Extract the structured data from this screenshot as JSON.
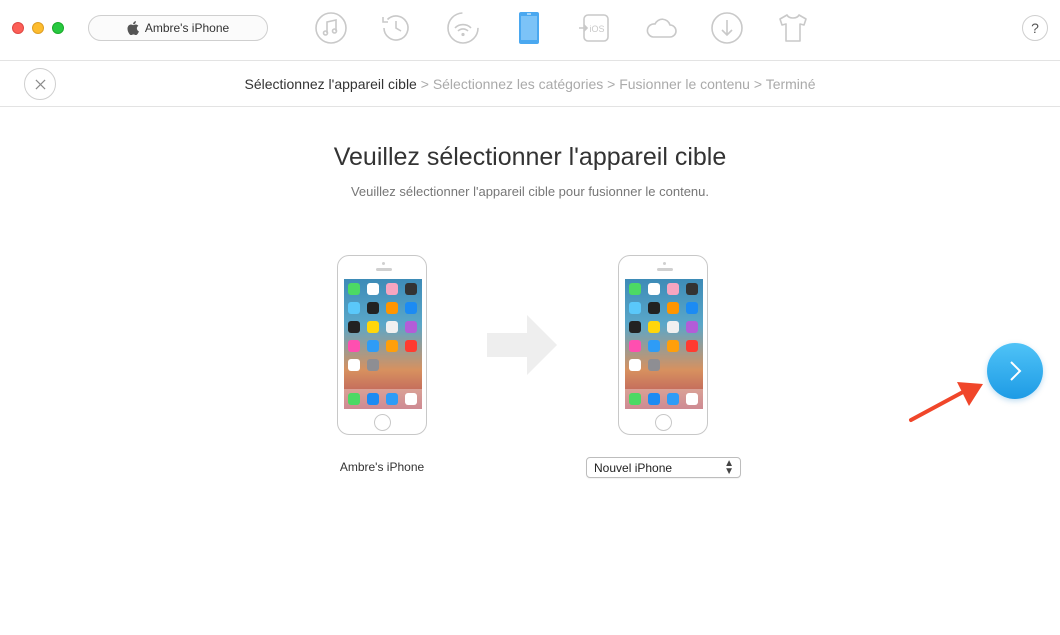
{
  "toolbar": {
    "device_name": "Ambre's iPhone",
    "icons": [
      "music-icon",
      "history-icon",
      "wifi-sync-icon",
      "iphone-icon",
      "ios-transfer-icon",
      "cloud-icon",
      "download-icon",
      "tshirt-icon"
    ],
    "active_icon": "iphone-icon",
    "help_label": "?"
  },
  "breadcrumb": {
    "steps": [
      "Sélectionnez l'appareil cible",
      "Sélectionnez les catégories",
      "Fusionner le contenu",
      "Terminé"
    ],
    "separator": " > ",
    "active_index": 0
  },
  "main": {
    "title": "Veuillez sélectionner l'appareil cible",
    "subtitle": "Veuillez sélectionner l'appareil cible pour fusionner le contenu."
  },
  "source_device": {
    "label": "Ambre's iPhone"
  },
  "target_device": {
    "selected": "Nouvel iPhone"
  },
  "colors": {
    "accent": "#2ea7ec",
    "red_arrow": "#f0462a",
    "active_icon": "#4aa8f0"
  }
}
